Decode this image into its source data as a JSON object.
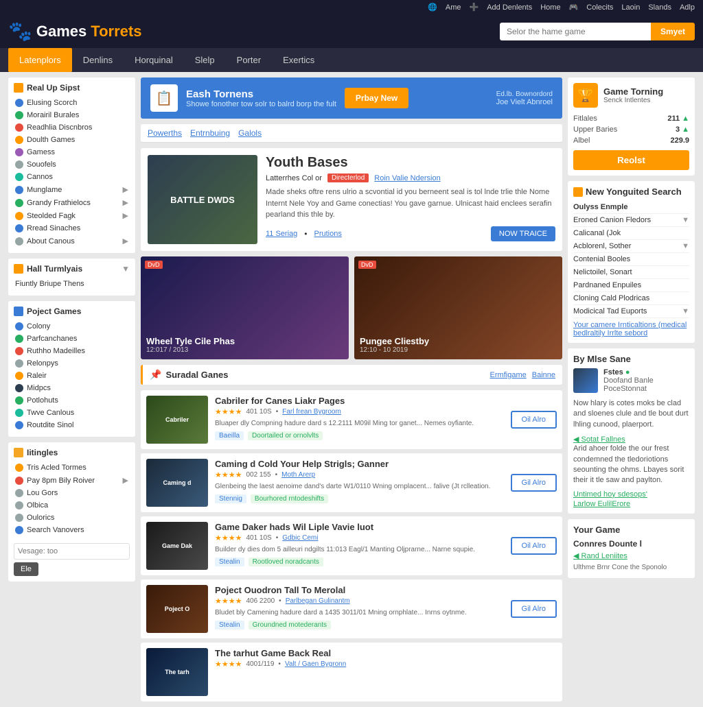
{
  "topbar": {
    "links": [
      "Ame",
      "Add Denlents",
      "Home",
      "Colecits",
      "Laoin",
      "Slands",
      "Adlp"
    ]
  },
  "header": {
    "logo_games": "Games",
    "logo_torrents": "Torrets",
    "search_placeholder": "Selor the hame game",
    "search_btn": "Smyet"
  },
  "nav": {
    "items": [
      "Latenplors",
      "Denlins",
      "Horquinal",
      "Slelp",
      "Porter",
      "Exertics"
    ],
    "active": "Latenplors"
  },
  "sidebar_left": {
    "section1_title": "Real Up Sipst",
    "items1": [
      {
        "label": "Elusing Scorch",
        "color": "blue"
      },
      {
        "label": "Morairil Burales",
        "color": "green"
      },
      {
        "label": "Readhlia Discnbros",
        "color": "red"
      },
      {
        "label": "Doulth Games",
        "color": "orange"
      },
      {
        "label": "Gamess",
        "color": "purple"
      },
      {
        "label": "Souofels",
        "color": "gray"
      },
      {
        "label": "Cannos",
        "color": "teal"
      },
      {
        "label": "Munglame",
        "color": "blue",
        "expand": true
      },
      {
        "label": "Grandy Frathielocs",
        "color": "green",
        "expand": true
      },
      {
        "label": "Steolded Fagk",
        "color": "orange",
        "expand": true
      },
      {
        "label": "Rread Sinaches",
        "color": "blue"
      },
      {
        "label": "About Canous",
        "color": "gray",
        "expand": true
      }
    ],
    "section2_title": "Hall Turmlyais",
    "items2": [
      {
        "label": "Fiuntly Briupe Thens"
      }
    ],
    "section3_title": "Poject Games",
    "items3": [
      {
        "label": "Colony",
        "color": "blue"
      },
      {
        "label": "Parfcanchanes",
        "color": "green"
      },
      {
        "label": "Ruthho Madeilles",
        "color": "red"
      },
      {
        "label": "Relonpys",
        "color": "gray"
      },
      {
        "label": "Raleir",
        "color": "orange"
      },
      {
        "label": "Midpcs",
        "color": "dark"
      },
      {
        "label": "Potlohuts",
        "color": "green"
      },
      {
        "label": "Twve Canlous",
        "color": "teal"
      },
      {
        "label": "Routdite Sinol",
        "color": "blue"
      }
    ],
    "section4_title": "Iitingles",
    "items4": [
      {
        "label": "Tris Acled Tormes",
        "color": "orange"
      },
      {
        "label": "Pay 8pm Bily Roiver",
        "color": "red",
        "expand": true
      },
      {
        "label": "Lou Gors",
        "color": "gray"
      },
      {
        "label": "Olbica",
        "color": "gray"
      },
      {
        "label": "Oulorics",
        "color": "gray"
      },
      {
        "label": "Search Vanovers",
        "color": "blue"
      }
    ],
    "search_placeholder": "Vesage: too",
    "search_btn": "Ele"
  },
  "banner": {
    "title": "Eash Tornens",
    "subtitle": "Showe fonother tow solr to balrd borp the fult",
    "btn": "Prbay New",
    "right_label": "Joe Vielt Abnroel"
  },
  "subnav": {
    "items": [
      "Powerths",
      "Entrnbuing",
      "Galols"
    ]
  },
  "featured": {
    "title": "Youth Bases",
    "meta_label": "Latterrhes Col or",
    "badge": "Directerlod",
    "link": "Roin Valie Ndersion",
    "desc": "Made sheks oftre rens ulrio a scvontial id you berneent seal is tol lnde trlie thle Nome Internt Nele Yoy and Game conectias! You gave garnue. Ulnicast haid enclees serafin pearland this thle by.",
    "action1": "11 Seriag",
    "action2": "Prutions",
    "now_btn": "NOW TRAICE"
  },
  "game_grid": {
    "card1_title": "Wheel Tyle Cile Phas",
    "card1_date": "12:017 / 2013",
    "card2_title": "Pungee Cliestby",
    "card2_date": "12:10 - 10 2019"
  },
  "suradal_section": {
    "title": "Suradal Ganes",
    "link1": "Ermfigame",
    "link2": "Bainne"
  },
  "game_list": [
    {
      "title": "Cabriler for Canes Liakr Pages",
      "stars": "★★★★",
      "rating": "401 10S",
      "meta": "Farl frean Bygroom",
      "desc": "Bluaper dly Compning hadure dard s 12.2111 M09il Ming tor ganet... Nemes oyfiante.",
      "tags": [
        "Baeilla",
        "Doortailed or ornolvlts"
      ],
      "btn": "Oil Alro",
      "img_class": "img-military"
    },
    {
      "title": "Caming d Cold Your Help Strigls; Ganner",
      "stars": "★★★★",
      "rating": "002 155",
      "meta": "Moth Arerp",
      "desc": "Glenbeing the laest aenoime dand's darte W1/0110 Wning ornplacent... falive (Jt rclleation.",
      "tags": [
        "Stennig",
        "Bourhored rntodeshifts"
      ],
      "btn": "Gil Alro",
      "img_class": "img-battle"
    },
    {
      "title": "Game Daker hads Wil Liple Vavie luot",
      "stars": "★★★★",
      "rating": "401 10S",
      "meta": "Gdbic Cemi",
      "desc": "Builder dy dies dom 5 ailleuri ndgilts 11:013 Eagl/1 Manting Oljprarne... Narne squpie.",
      "tags": [
        "Stealin",
        "Rootloved noradcants"
      ],
      "btn": "Oil Alro",
      "img_class": "img-bee"
    },
    {
      "title": "Poject Ouodron Tall To Merolal",
      "stars": "★★★★",
      "rating": "406 2200",
      "meta": "Parlbegan Gulinantm",
      "desc": "Bludet bly Camening hadure dard a 1435 3011/01 Mning ornphlate... Inrns oytnme.",
      "tags": [
        "Stealin",
        "Groundned motederants"
      ],
      "btn": "Gil Alro",
      "img_class": "img-squad"
    },
    {
      "title": "The tarhut Game Back Real",
      "stars": "★★★★",
      "rating": "4001/119",
      "meta": "Valt / Gaen Bygronn",
      "desc": "",
      "tags": [],
      "btn": "",
      "img_class": "img-real"
    }
  ],
  "right_sidebar": {
    "game_torning_title": "Game Torning",
    "game_torning_sub": "Senck Intlentes",
    "stats": {
      "fitlales_label": "Fitlales",
      "fitlales_value": "211",
      "upper_label": "Upper Baries",
      "upper_value": "3",
      "albel_label": "Albel",
      "albel_value": "229.9"
    },
    "realist_btn": "Reolst",
    "new_search_title": "New Yonguited Search",
    "search_items": [
      {
        "label": "Oulyss Enmple",
        "expand": false,
        "header": true
      },
      {
        "label": "Eroned Canion Fledors",
        "expand": true
      },
      {
        "label": "Calicanal (Jok",
        "expand": false
      },
      {
        "label": "Acblorenl, Sother",
        "expand": true
      },
      {
        "label": "Contenial Booles",
        "expand": false
      },
      {
        "label": "Nelictoilel, Sonart",
        "expand": false
      },
      {
        "label": "Pardnaned Enpuiles",
        "expand": false
      },
      {
        "label": "Cloning Cald Plodricas",
        "expand": false
      },
      {
        "label": "Modicical Tad Euports",
        "expand": true
      }
    ],
    "more_link": "Your camere Irnticaltions (medical bedlraltily Irrlte sebord",
    "by_user_title": "By Mlse Sane",
    "user": {
      "name": "Fstes",
      "sub1": "Doofand Banle",
      "sub2": "PoceStonnat"
    },
    "user_desc": "Now hlary is cotes moks be clad and sloenes clule and tle bout durt lhling cunood, plaerport.",
    "stat_link": "Sotat Fallnes",
    "stat_text": "Arid ahoer folde the our frest condemned the tledoriotions seounting the ohms. Lbayes sorit their it tle saw and paylton.",
    "stat_link2": "Untimed hoy sdesops'",
    "stat_link3": "Larlow EulilErore",
    "your_game_title": "Your Game",
    "connects_title": "Connres Dounte l",
    "rand_link": "Rand Leniites",
    "small_text": "Ulthme Brnr Cone the Sponolo"
  }
}
